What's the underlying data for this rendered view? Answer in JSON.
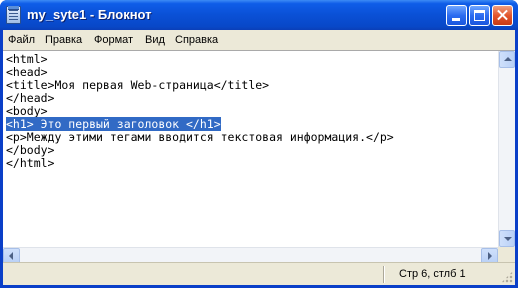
{
  "window": {
    "title": "my_syte1 - Блокнот",
    "title_color": "#0a50d6"
  },
  "menu": {
    "items": [
      "Файл",
      "Правка",
      "Формат",
      "Вид",
      "Справка"
    ]
  },
  "editor": {
    "lines": [
      "<html>",
      "<head>",
      "<title>Моя первая Web-страница</title>",
      "</head>",
      "<body>",
      "<h1> Это первый заголовок </h1>",
      "<p>Между этими тегами вводится текстовая информация.</p>",
      "</body>",
      "</html>"
    ],
    "selected_line": 6,
    "selection_color": "#316ac5"
  },
  "status": {
    "position": "Стр 6, стлб 1"
  }
}
